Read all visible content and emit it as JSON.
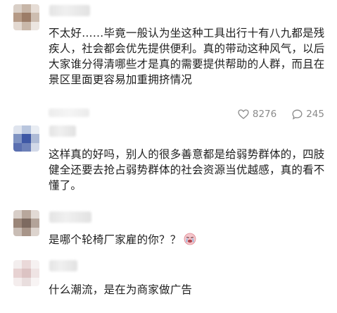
{
  "comments": [
    {
      "text": "不太好……毕竟一般认为坐这种工具出行十有八九都是残疾人，社会都会优先提供便利。真的带动这种风气，以后大家谁分得清哪些才是真的需要提供帮助的人群，而且在景区里面更容易加重拥挤情况",
      "likes": "8276",
      "replies": "245",
      "like_icon": "heart-outline-icon",
      "reply_icon": "comment-bubble-icon"
    },
    {
      "text": "这样真的好吗，别人的很多善意都是给弱势群体的，四肢健全还要去抢占弱势群体的社会资源当优越感，真的看不懂了。"
    },
    {
      "text": "是哪个轮椅厂家雇的你？？",
      "emoji": "crying-face-emoji"
    },
    {
      "text": "什么潮流，是在为商家做广告"
    }
  ],
  "colors": {
    "text": "#202020",
    "meta": "#8a8a8a",
    "emoji_face": "#f2a0a8"
  }
}
